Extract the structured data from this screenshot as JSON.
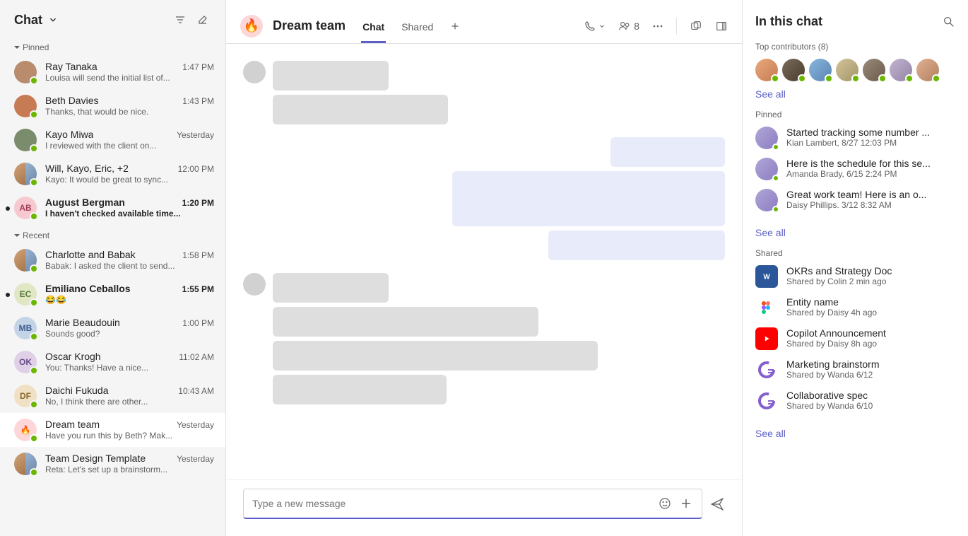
{
  "sidebar": {
    "title": "Chat",
    "sections": {
      "pinned": "Pinned",
      "recent": "Recent"
    },
    "pinned_chats": [
      {
        "name": "Ray Tanaka",
        "time": "1:47 PM",
        "preview": "Louisa will send the initial list of...",
        "unread": false,
        "initials": "",
        "color": "#b88c6c"
      },
      {
        "name": "Beth Davies",
        "time": "1:43 PM",
        "preview": "Thanks, that would be nice.",
        "unread": false,
        "initials": "",
        "color": "#c77b54"
      },
      {
        "name": "Kayo Miwa",
        "time": "Yesterday",
        "preview": "I reviewed with the client on...",
        "unread": false,
        "initials": "",
        "color": "#7a8c6c"
      },
      {
        "name": "Will, Kayo, Eric, +2",
        "time": "12:00 PM",
        "preview": "Kayo: It would be great to sync...",
        "unread": false,
        "initials": "",
        "color": "split"
      },
      {
        "name": "August Bergman",
        "time": "1:20 PM",
        "preview": "I haven't checked available time...",
        "unread": true,
        "initials": "AB",
        "color": "#f7c9cf"
      }
    ],
    "recent_chats": [
      {
        "name": "Charlotte and Babak",
        "time": "1:58 PM",
        "preview": "Babak: I asked the client to send...",
        "unread": false,
        "initials": "",
        "color": "split2"
      },
      {
        "name": "Emiliano Ceballos",
        "time": "1:55 PM",
        "preview": "😂😂",
        "unread": true,
        "initials": "EC",
        "color": "#e0e7c4"
      },
      {
        "name": "Marie Beaudouin",
        "time": "1:00 PM",
        "preview": "Sounds good?",
        "unread": false,
        "initials": "MB",
        "color": "#c4d4e7"
      },
      {
        "name": "Oscar Krogh",
        "time": "11:02 AM",
        "preview": "You: Thanks! Have a nice...",
        "unread": false,
        "initials": "OK",
        "color": "#e0d0e7"
      },
      {
        "name": "Daichi Fukuda",
        "time": "10:43 AM",
        "preview": "No, I think there are other...",
        "unread": false,
        "initials": "DF",
        "color": "#f0e0c4"
      },
      {
        "name": "Dream team",
        "time": "Yesterday",
        "preview": "Have you run this by Beth? Mak...",
        "unread": false,
        "initials": "🔥",
        "color": "#fdd7d7",
        "active": true
      },
      {
        "name": "Team Design Template",
        "time": "Yesterday",
        "preview": "Reta: Let's set up a brainstorm...",
        "unread": false,
        "initials": "",
        "color": "split3"
      }
    ]
  },
  "header": {
    "icon": "🔥",
    "title": "Dream team",
    "tabs": [
      {
        "label": "Chat",
        "active": true
      },
      {
        "label": "Shared",
        "active": false
      }
    ],
    "participants_count": "8"
  },
  "composer": {
    "placeholder": "Type a new message"
  },
  "right": {
    "title": "In this chat",
    "contributors_label": "Top contributors (8)",
    "see_all": "See all",
    "pinned_label": "Pinned",
    "pinned": [
      {
        "title": "Started tracking some number ...",
        "sub": "Kian Lambert, 8/27 12:03 PM"
      },
      {
        "title": "Here is the schedule for this se...",
        "sub": "Amanda Brady, 6/15 2:24 PM"
      },
      {
        "title": "Great work team! Here is an o...",
        "sub": "Daisy Phillips. 3/12 8:32 AM"
      }
    ],
    "shared_label": "Shared",
    "shared": [
      {
        "title": "OKRs and Strategy Doc",
        "sub": "Shared by Colin 2 min ago",
        "icon": "word",
        "color": "#2b579a"
      },
      {
        "title": "Entity name",
        "sub": "Shared by Daisy 4h ago",
        "icon": "figma",
        "color": "#fff"
      },
      {
        "title": "Copilot Announcement",
        "sub": "Shared by Daisy 8h ago",
        "icon": "youtube",
        "color": "#ff0000"
      },
      {
        "title": "Marketing brainstorm",
        "sub": "Shared by Wanda 6/12",
        "icon": "loop",
        "color": "#8660cc"
      },
      {
        "title": "Collaborative spec",
        "sub": "Shared by Wanda 6/10",
        "icon": "loop",
        "color": "#8660cc"
      }
    ]
  }
}
